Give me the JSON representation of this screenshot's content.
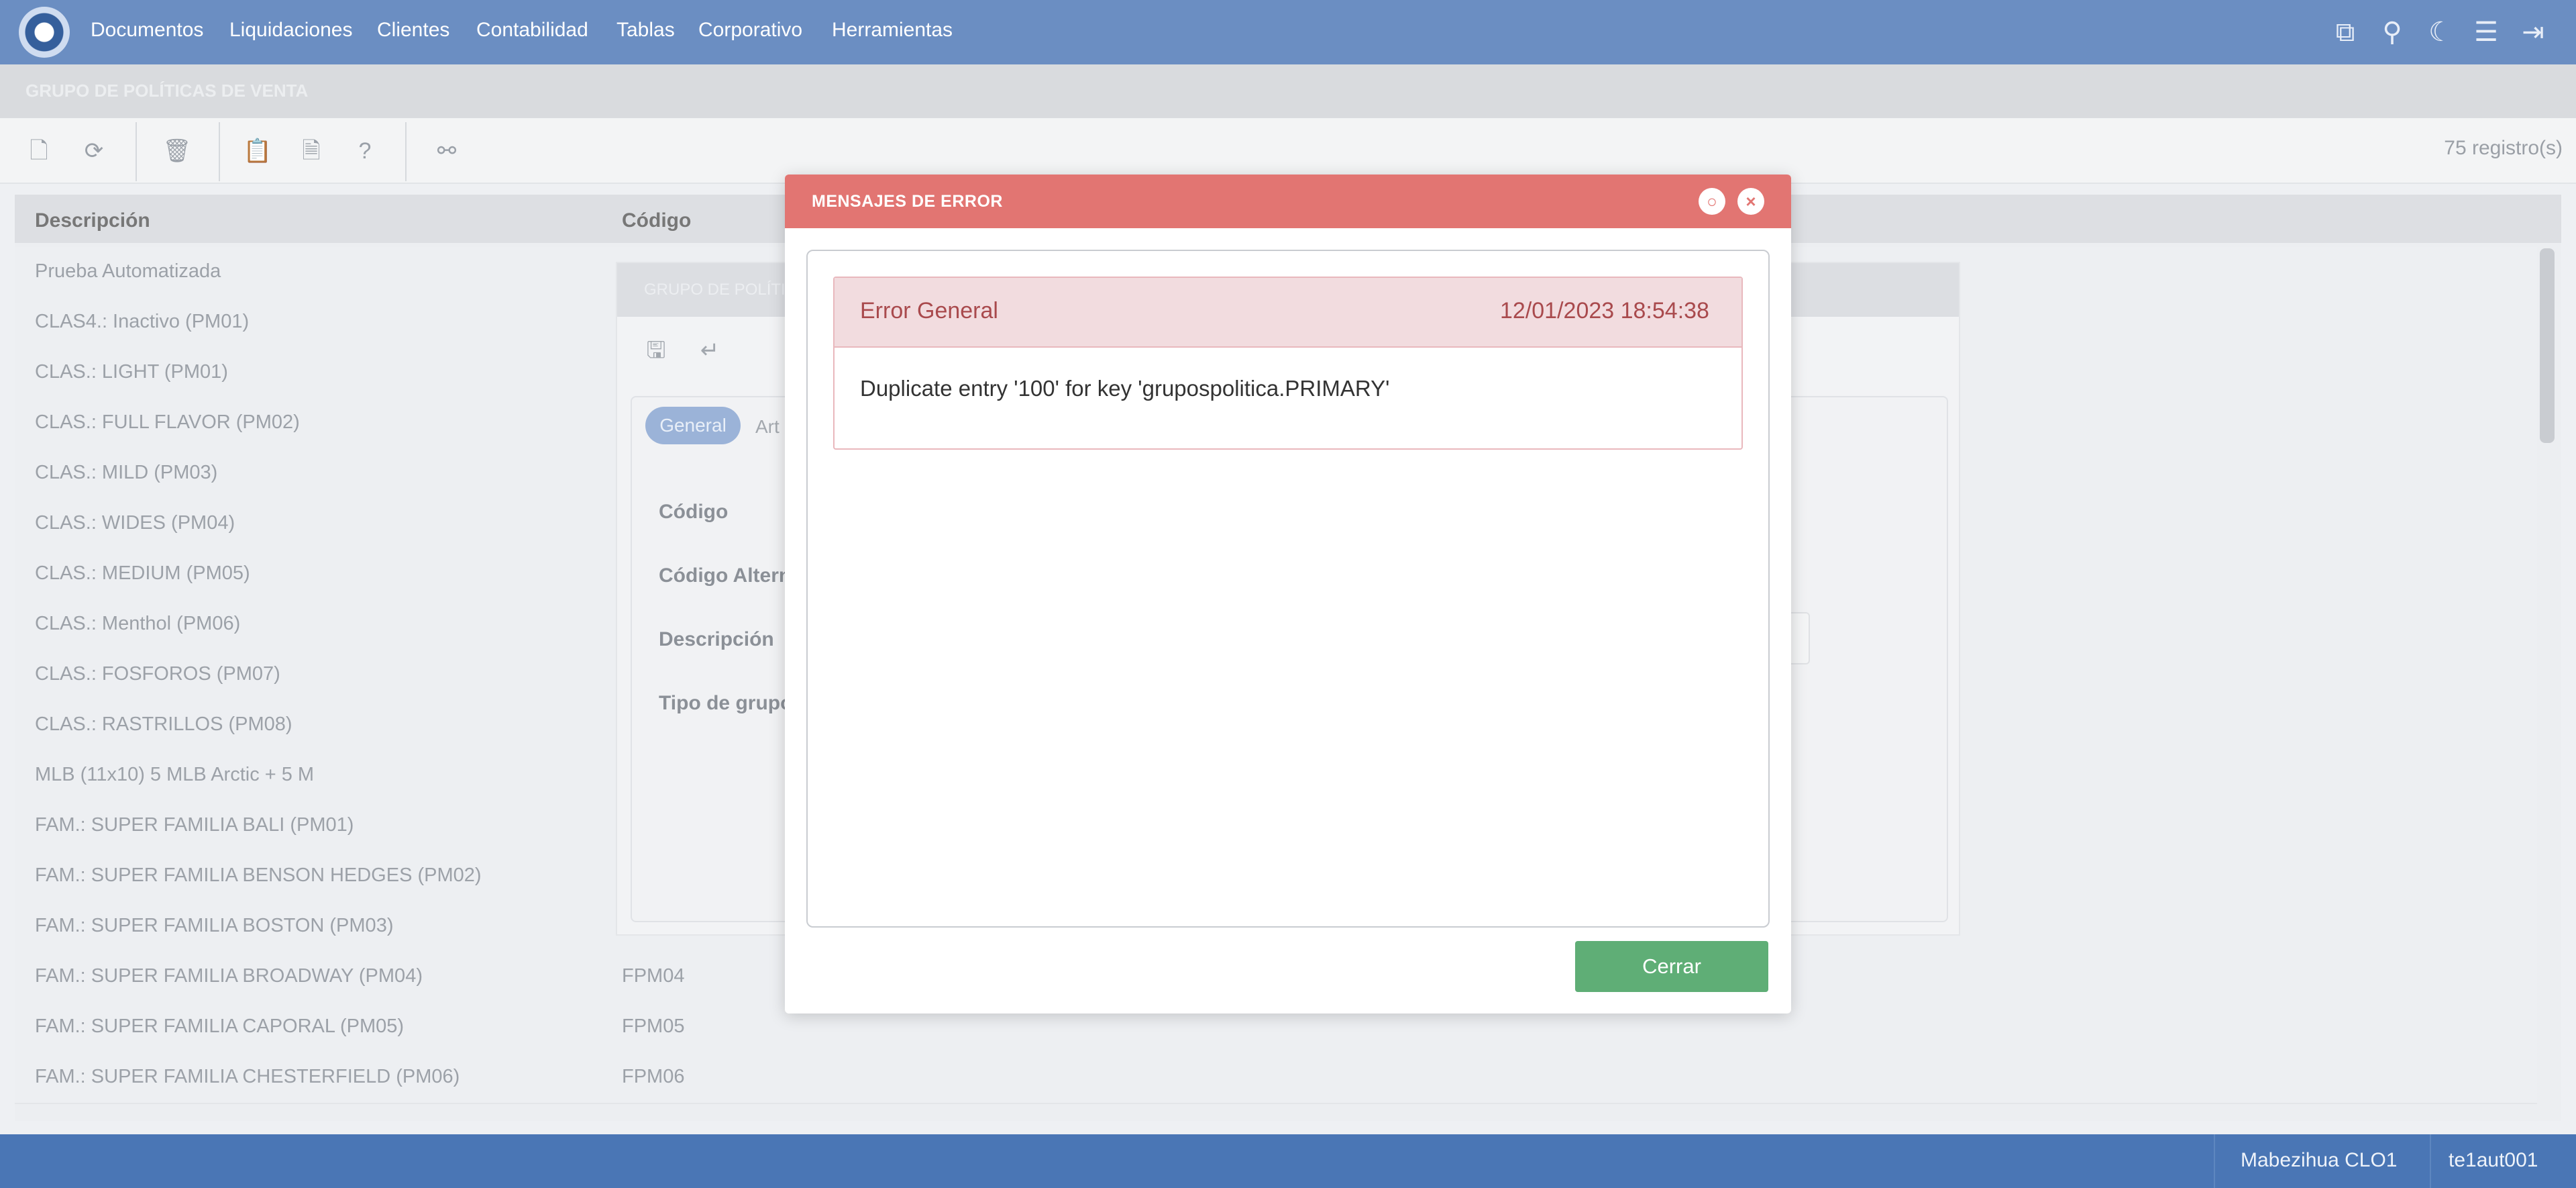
{
  "nav": {
    "items": [
      "Documentos",
      "Liquidaciones",
      "Clientes",
      "Contabilidad",
      "Tablas",
      "Corporativo",
      "Herramientas"
    ],
    "icons": [
      "windows-icon",
      "search-icon",
      "moon-icon",
      "menu-icon",
      "logout-icon"
    ]
  },
  "page": {
    "title": "GRUPO DE POLÍTICAS DE VENTA",
    "record_count": "75 registro(s)"
  },
  "toolbar": {
    "icons": [
      "new-document-icon",
      "refresh-icon",
      "delete-icon",
      "clipboard-icon",
      "export-icon",
      "help-icon",
      "binoculars-icon"
    ]
  },
  "table": {
    "headers": [
      "Descripción",
      "Código"
    ],
    "rows": [
      {
        "desc": "Prueba Automatizada",
        "code": ""
      },
      {
        "desc": "CLAS4.: Inactivo (PM01)",
        "code": ""
      },
      {
        "desc": "CLAS.: LIGHT (PM01)",
        "code": ""
      },
      {
        "desc": "CLAS.: FULL FLAVOR (PM02)",
        "code": ""
      },
      {
        "desc": "CLAS.: MILD (PM03)",
        "code": ""
      },
      {
        "desc": "CLAS.: WIDES (PM04)",
        "code": ""
      },
      {
        "desc": "CLAS.: MEDIUM (PM05)",
        "code": ""
      },
      {
        "desc": "CLAS.: Menthol (PM06)",
        "code": ""
      },
      {
        "desc": "CLAS.: FOSFOROS (PM07)",
        "code": ""
      },
      {
        "desc": "CLAS.: RASTRILLOS (PM08)",
        "code": ""
      },
      {
        "desc": "MLB (11x10) 5 MLB Arctic + 5 M",
        "code": ""
      },
      {
        "desc": "FAM.: SUPER FAMILIA BALI (PM01)",
        "code": ""
      },
      {
        "desc": "FAM.: SUPER FAMILIA BENSON HEDGES (PM02)",
        "code": ""
      },
      {
        "desc": "FAM.: SUPER FAMILIA BOSTON (PM03)",
        "code": ""
      },
      {
        "desc": "FAM.: SUPER FAMILIA BROADWAY (PM04)",
        "code": "FPM04"
      },
      {
        "desc": "FAM.: SUPER FAMILIA CAPORAL (PM05)",
        "code": "FPM05"
      },
      {
        "desc": "FAM.: SUPER FAMILIA CHESTERFIELD (PM06)",
        "code": "FPM06"
      }
    ]
  },
  "form_dialog": {
    "title": "GRUPO DE POLÍTI",
    "tabs": [
      "General",
      "Art"
    ],
    "labels": [
      "Código",
      "Código Altern",
      "Descripción",
      "Tipo de grupo"
    ]
  },
  "error_modal": {
    "title": "MENSAJES DE ERROR",
    "error_title": "Error General",
    "error_time": "12/01/2023 18:54:38",
    "error_text": "Duplicate entry '100' for key 'grupospolitica.PRIMARY'",
    "close_button": "Cerrar"
  },
  "status": {
    "user": "Mabezihua CLO1",
    "instance": "te1aut001"
  }
}
